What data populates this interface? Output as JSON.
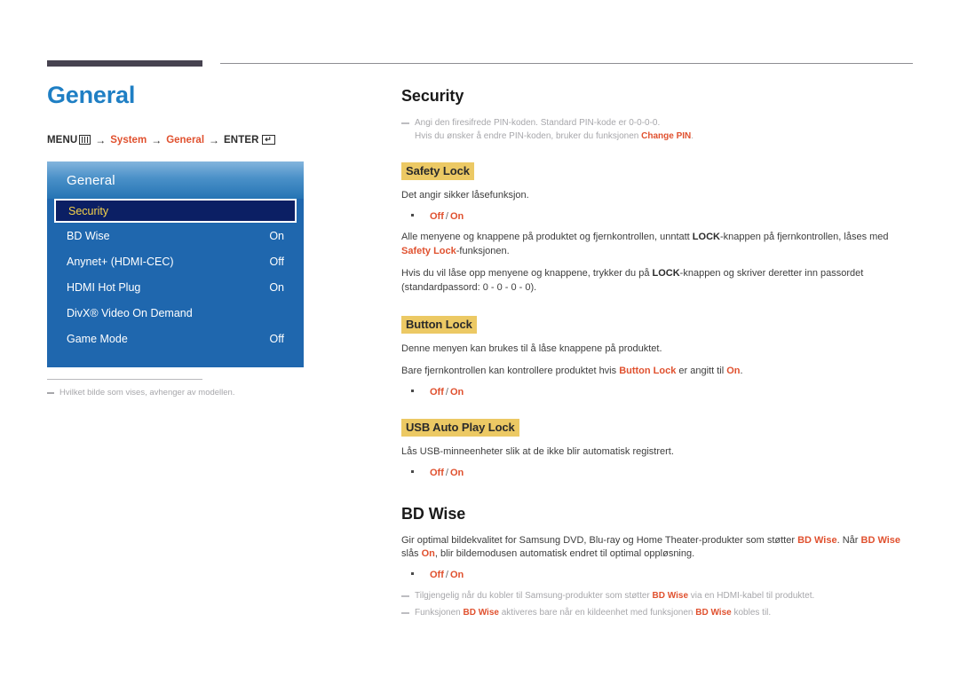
{
  "chapter": {
    "title": "General"
  },
  "breadcrumb": {
    "menu_label": "MENU",
    "menu_icon": "menu-bars-icon",
    "arrow": "→",
    "step1": "System",
    "step2": "General",
    "enter_label": "ENTER",
    "enter_icon": "enter-return-icon",
    "enter_glyph": "↵"
  },
  "osd": {
    "header_title": "General",
    "rows": [
      {
        "label": "Security",
        "value": "",
        "selected": true
      },
      {
        "label": "BD Wise",
        "value": "On",
        "selected": false
      },
      {
        "label": "Anynet+ (HDMI-CEC)",
        "value": "Off",
        "selected": false
      },
      {
        "label": "HDMI Hot Plug",
        "value": "On",
        "selected": false
      },
      {
        "label": "DivX® Video On Demand",
        "value": "",
        "selected": false
      },
      {
        "label": "Game Mode",
        "value": "Off",
        "selected": false
      }
    ]
  },
  "left_note": "Hvilket bilde som vises, avhenger av modellen.",
  "security": {
    "title": "Security",
    "note_line1": "Angi den firesifrede PIN-koden. Standard PIN-kode er 0-0-0-0.",
    "note_line2_pre": "Hvis du ønsker å endre PIN-koden, bruker du funksjonen ",
    "note_line2_link": "Change PIN",
    "note_line2_post": "."
  },
  "safety_lock": {
    "title": "Safety Lock",
    "desc": "Det angir sikker låsefunksjon.",
    "options_off": "Off",
    "options_sep": "/",
    "options_on": "On",
    "para1_a": "Alle menyene og knappene på produktet og fjernkontrollen, unntatt ",
    "para1_lock": "LOCK",
    "para1_b": "-knappen på fjernkontrollen, låses med ",
    "para1_safety": "Safety Lock",
    "para1_c": "-funksjonen.",
    "para2_a": "Hvis du vil låse opp menyene og knappene, trykker du på ",
    "para2_lock": "LOCK",
    "para2_b": "-knappen og skriver deretter inn passordet (standardpassord: 0 - 0 - 0 - 0)."
  },
  "button_lock": {
    "title": "Button Lock",
    "desc": "Denne menyen kan brukes til å låse knappene på produktet.",
    "para_a": "Bare fjernkontrollen kan kontrollere produktet hvis ",
    "para_name": "Button Lock",
    "para_b": " er angitt til ",
    "para_on": "On",
    "para_c": ".",
    "options_off": "Off",
    "options_sep": "/",
    "options_on": "On"
  },
  "usb_auto_play_lock": {
    "title": "USB Auto Play Lock",
    "desc": "Lås USB-minneenheter slik at de ikke blir automatisk registrert.",
    "options_off": "Off",
    "options_sep": "/",
    "options_on": "On"
  },
  "bd_wise": {
    "title": "BD Wise",
    "para_a": "Gir optimal bildekvalitet for Samsung DVD, Blu-ray og Home Theater-produkter som støtter ",
    "para_name1": "BD Wise",
    "para_b": ". Når ",
    "para_name2": "BD Wise",
    "para_c": " slås ",
    "para_on": "On",
    "para_d": ", blir bildemodusen automatisk endret til optimal oppløsning.",
    "options_off": "Off",
    "options_sep": "/",
    "options_on": "On",
    "note1_a": "Tilgjengelig når du kobler til Samsung-produkter som støtter ",
    "note1_name": "BD Wise",
    "note1_b": " via en HDMI-kabel til produktet.",
    "note2_a": "Funksjonen ",
    "note2_name1": "BD Wise",
    "note2_b": " aktiveres bare når en kildeenhet med funksjonen ",
    "note2_name2": "BD Wise",
    "note2_c": " kobles til."
  },
  "colors": {
    "chapter_blue": "#1f7fc4",
    "accent_orange": "#e0512f",
    "highlight_yellow": "#ecc964",
    "osd_blue": "#1f67ae",
    "osd_selected": "#0b1f64",
    "osd_selected_text": "#f5d24a",
    "rule_dark": "#474350",
    "note_gray": "#a7a7ab"
  }
}
